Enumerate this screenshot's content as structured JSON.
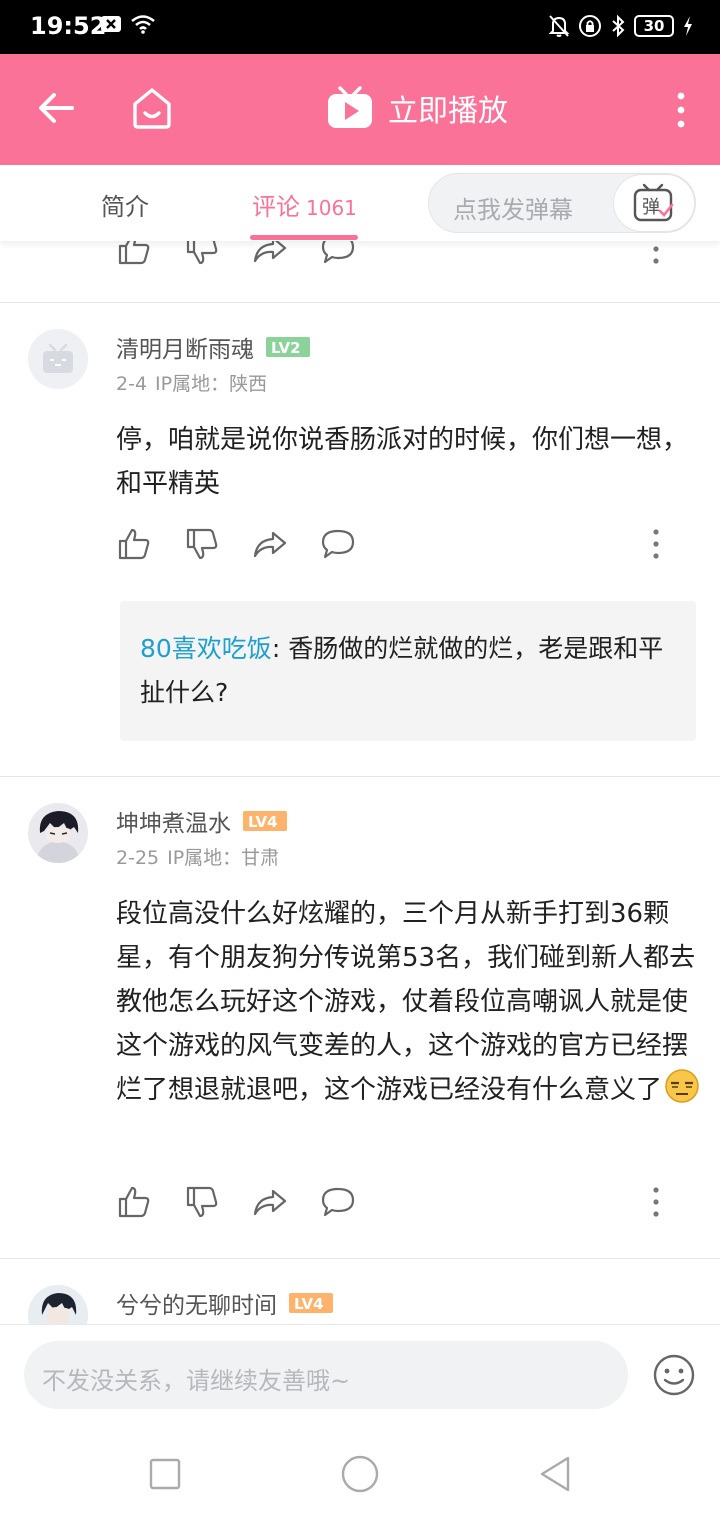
{
  "status_bar": {
    "time": "19:52",
    "battery": "30",
    "icons": [
      "close-box-icon",
      "wifi-icon",
      "bell-off-icon",
      "lock-rotation-icon",
      "bluetooth-icon",
      "battery-icon",
      "charging-icon"
    ]
  },
  "app_bar": {
    "play_label": "立即播放",
    "icons": [
      "back-arrow-icon",
      "home-tv-icon",
      "play-tv-icon",
      "more-vertical-icon"
    ],
    "color": "#fb7299"
  },
  "tabs": {
    "intro": "简介",
    "comments": "评论",
    "comments_count": "1061",
    "danmaku_placeholder": "点我发弹幕",
    "danmaku_button": "弹"
  },
  "comments": [
    {
      "username": "清明月断雨魂",
      "level": "LV2",
      "date": "2-4",
      "ip_label": "IP属地：陕西",
      "text": "停，咱就是说你说香肠派对的时候，你们想一想，和平精英",
      "reply": {
        "user": "80喜欢吃饭",
        "sep": ":",
        "text": " 香肠做的烂就做的烂，老是跟和平扯什么?"
      }
    },
    {
      "username": "坤坤煮温水",
      "level": "LV4",
      "date": "2-25",
      "ip_label": "IP属地：甘肃",
      "text": "段位高没什么好炫耀的，三个月从新手打到36颗星，有个朋友狗分传说第53名，我们碰到新人都去教他怎么玩好这个游戏，仗着段位高嘲讽人就是使这个游戏的风气变差的人，这个游戏的官方已经摆烂了想退就退吧，这个游戏已经没有什么意义了"
    },
    {
      "username": "兮兮的无聊时间",
      "level": "LV4"
    }
  ],
  "bottom": {
    "input_placeholder": "不发没关系，请继续友善哦~"
  },
  "colors": {
    "accent": "#fb7299",
    "reply_user": "#1e9fcf",
    "lv2": "#8bd29b",
    "lv4": "#feb36c"
  }
}
